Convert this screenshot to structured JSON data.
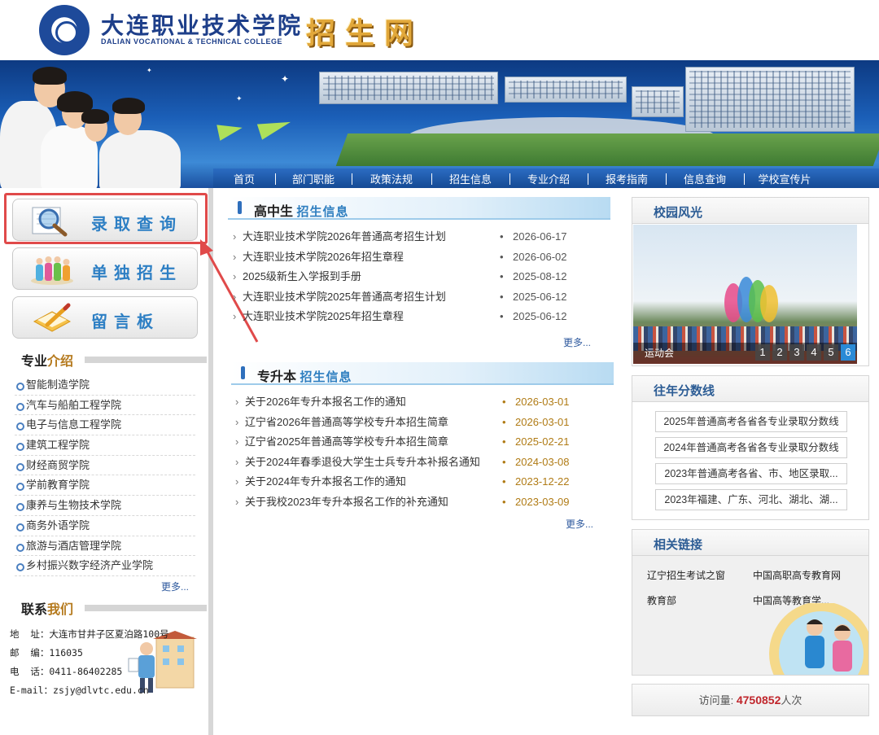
{
  "header": {
    "college_cn": "大连职业技术学院",
    "college_en": "DALIAN VOCATIONAL & TECHNICAL COLLEGE",
    "site_name": "招生网"
  },
  "nav": [
    "首页",
    "部门职能",
    "政策法规",
    "招生信息",
    "专业介绍",
    "报考指南",
    "信息查询",
    "学校宣传片"
  ],
  "sidebar": {
    "buttons": [
      "录取查询",
      "单独招生",
      "留言板"
    ],
    "majors_title_a": "专业",
    "majors_title_b": "介绍",
    "majors": [
      "智能制造学院",
      "汽车与船舶工程学院",
      "电子与信息工程学院",
      "建筑工程学院",
      "财经商贸学院",
      "学前教育学院",
      "康养与生物技术学院",
      "商务外语学院",
      "旅游与酒店管理学院",
      "乡村振兴数字经济产业学院"
    ],
    "more": "更多...",
    "contact_title_a": "联系",
    "contact_title_b": "我们",
    "contact": [
      "地  址：大连市甘井子区夏泊路100号",
      "邮  编：116035",
      "电  话：0411-86402285",
      "E-mail：zsjy@dlvtc.edu.cn"
    ]
  },
  "high_school": {
    "title_a": "高中生",
    "title_b": "招生信息",
    "items": [
      {
        "title": "大连职业技术学院2026年普通高考招生计划",
        "date": "2026-06-17"
      },
      {
        "title": "大连职业技术学院2026年招生章程",
        "date": "2026-06-02"
      },
      {
        "title": "2025级新生入学报到手册",
        "date": "2025-08-12"
      },
      {
        "title": "大连职业技术学院2025年普通高考招生计划",
        "date": "2025-06-12"
      },
      {
        "title": "大连职业技术学院2025年招生章程",
        "date": "2025-06-12"
      }
    ],
    "more": "更多..."
  },
  "upgrade": {
    "title_a": "专升本",
    "title_b": "招生信息",
    "items": [
      {
        "title": "关于2026年专升本报名工作的通知",
        "date": "2026-03-01"
      },
      {
        "title": "辽宁省2026年普通高等学校专升本招生简章",
        "date": "2026-03-01"
      },
      {
        "title": "辽宁省2025年普通高等学校专升本招生简章",
        "date": "2025-02-21"
      },
      {
        "title": "关于2024年春季退役大学生士兵专升本补报名通知",
        "date": "2024-03-08"
      },
      {
        "title": "关于2024年专升本报名工作的通知",
        "date": "2023-12-22"
      },
      {
        "title": "关于我校2023年专升本报名工作的补充通知",
        "date": "2023-03-09"
      }
    ],
    "more": "更多..."
  },
  "right": {
    "campus_title": "校园风光",
    "campus_caption": "运动会",
    "pages": [
      "1",
      "2",
      "3",
      "4",
      "5",
      "6"
    ],
    "scores_title": "往年分数线",
    "scores": [
      "2025年普通高考各省各专业录取分数线",
      "2024年普通高考各省各专业录取分数线",
      "2023年普通高考各省、市、地区录取...",
      "2023年福建、广东、河北、湖北、湖..."
    ],
    "links_title": "相关链接",
    "links": [
      "辽宁招生考试之窗",
      "中国高职高专教育网",
      "教育部",
      "中国高等教育学..."
    ],
    "visits_label": "访问量:",
    "visits_count": "4750852",
    "visits_unit": "人次"
  },
  "colors": {
    "nav_bg": "#1f5aa8",
    "accent_gold": "#b57a1e",
    "link_blue": "#2d5d95",
    "highlight_red": "#e04a4a"
  }
}
